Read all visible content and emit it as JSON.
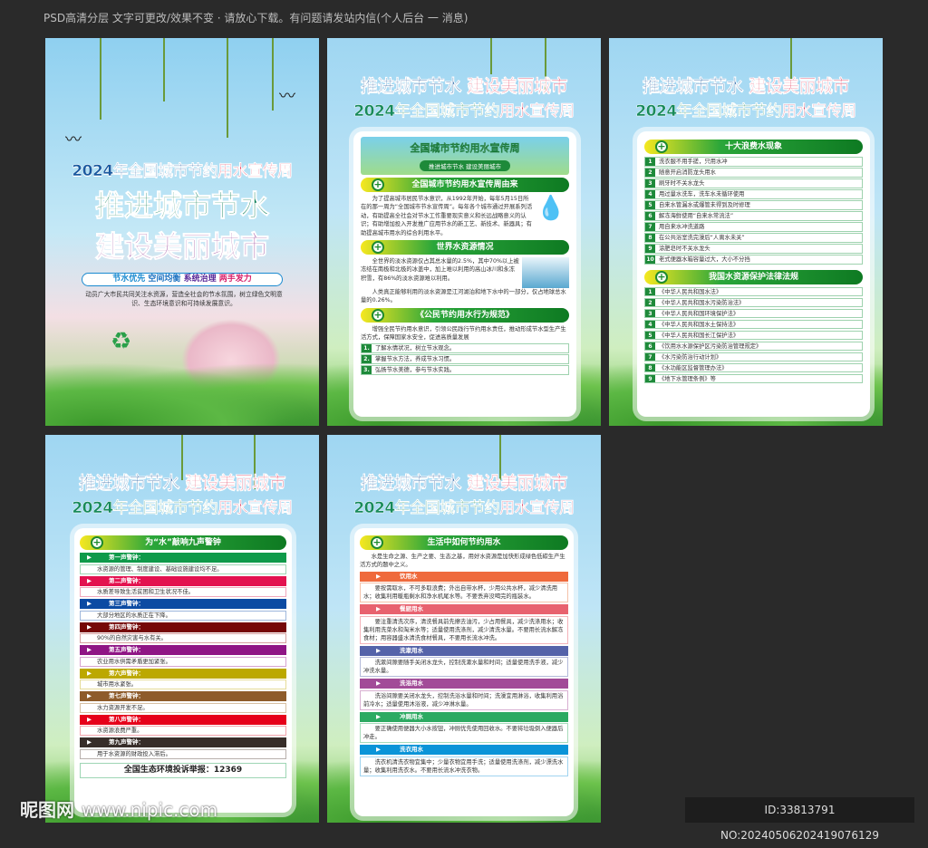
{
  "top_note": "PSD高清分层 文字可更改/效果不变 · 请放心下载。有问题请发站内信(个人后台 一 消息)",
  "headline_a": "推进城市节水",
  "headline_b": "建设美丽城市",
  "headline_b1": "建设",
  "headline_b2": "美丽城市",
  "week_title": "2024年全国城市节约用水宣传周",
  "week_title_a": "2024年全国城市节约",
  "week_title_b": "用水宣传周",
  "cover": {
    "tagline": [
      "节水优先",
      "空间均衡",
      "系统治理",
      "两手发力"
    ],
    "tagline_colors": [
      "#1a8ad0",
      "#1a70c0",
      "#5a2a9a",
      "#d8206a"
    ],
    "body": "动员广大市民共同关注水资源，营造全社会的节水氛围，树立绿色文明意识、生态环境意识和可持续发展意识。"
  },
  "poster2": {
    "banner_title": "全国城市节约用水宣传周",
    "banner_sub": "推进城市节水 建设美丽城市",
    "sec1_title": "全国城市节约用水宣传周由来",
    "sec1_body": "为了提高城市居民节水意识，从1992年开始，每年5月15日所在的那一周为“全国城市节水宣传周”。每年各个城市通过开展系列活动，有助提高全社会对节水工作重要现实意义和长远战略意义的认识；有助增加投入开发推广应用节水的新工艺、新技术、新器具；有助提高城市用水的综合利用水平。",
    "sec2_title": "世界水资源情况",
    "sec2_body1": "全世界的淡水资源仅占其总水量的2.5%，其中70%以上被冻结在南极和北极的冰盖中，加上难以利用的高山冰川和永冻积雪，有86%的淡水资源难以利用。",
    "sec2_body2": "人类真正能够利用的淡水资源是江河湖泊和地下水中的一部分，仅占地球总水量的0.26%。",
    "sec3_title": "《公民节约用水行为规范》",
    "sec3_body": "增强全民节约用水意识，引领公民践行节约用水责任，推动形成节水型生产生活方式，保障国家水安全，促进高质量发展",
    "rules": [
      {
        "n": "1.",
        "t": "了解水情状况，树立节水观念。"
      },
      {
        "n": "2.",
        "t": "掌握节水方法，养成节水习惯。"
      },
      {
        "n": "3.",
        "t": "弘扬节水美德，参与节水实践。"
      }
    ]
  },
  "poster3": {
    "waste_title": "十大浪费水现象",
    "waste": [
      {
        "n": "1",
        "t": "洗衣服不用手搓，只用水冲"
      },
      {
        "n": "2",
        "t": "随意开启消防龙头用水"
      },
      {
        "n": "3",
        "t": "刷牙时不关水龙头"
      },
      {
        "n": "4",
        "t": "用过量水洗车，洗车水未循环使用"
      },
      {
        "n": "5",
        "t": "自来水管漏水或爆管未得到及时修理"
      },
      {
        "n": "6",
        "t": "解冻海鲜使用“自来水常流法”"
      },
      {
        "n": "7",
        "t": "用自来水冲洗道路"
      },
      {
        "n": "8",
        "t": "在公共浴室洗完澡后“人离水未关”"
      },
      {
        "n": "9",
        "t": "涂肥皂时不关水龙头"
      },
      {
        "n": "10",
        "t": "老式便器水箱容量过大，大小不分挡"
      }
    ],
    "law_title": "我国水资源保护法律法规",
    "laws": [
      {
        "n": "1",
        "t": "《中华人民共和国水法》"
      },
      {
        "n": "2",
        "t": "《中华人民共和国水污染防治法》"
      },
      {
        "n": "3",
        "t": "《中华人民共和国环境保护法》"
      },
      {
        "n": "4",
        "t": "《中华人民共和国水土保持法》"
      },
      {
        "n": "5",
        "t": "《中华人民共和国长江保护法》"
      },
      {
        "n": "6",
        "t": "《饮用水水源保护区污染防治管理规定》"
      },
      {
        "n": "7",
        "t": "《水污染防治行动计划》"
      },
      {
        "n": "8",
        "t": "《水功能区监督管理办法》"
      },
      {
        "n": "9",
        "t": "《地下水管理条例》等"
      }
    ]
  },
  "poster4": {
    "title": "为“水”敲响九声警钟",
    "alarms": [
      {
        "h": "第一声警钟：",
        "b": "水资源的管理、制度建设、基础设施建设均不足。",
        "color": "#0f9a4a",
        "light": "#9ed6b4"
      },
      {
        "h": "第二声警钟：",
        "b": "水质差导致生活贫困和卫生状况不佳。",
        "color": "#e3124f",
        "light": "#f2a8bc"
      },
      {
        "h": "第三声警钟：",
        "b": "大部分地区的水质正在下降。",
        "color": "#0c4ba3",
        "light": "#9fb8dc"
      },
      {
        "h": "第四声警钟：",
        "b": "90%的自然灾害与水有关。",
        "color": "#760808",
        "light": "#d6a0a0"
      },
      {
        "h": "第五声警钟：",
        "b": "农业用水供需矛盾更加紧张。",
        "color": "#8f1585",
        "light": "#d8a4d2"
      },
      {
        "h": "第六声警钟：",
        "b": "城市用水紧张。",
        "color": "#bca800",
        "light": "#e6dc98"
      },
      {
        "h": "第七声警钟：",
        "b": "水力资源开发不足。",
        "color": "#8e5b2a",
        "light": "#d8c0a4"
      },
      {
        "h": "第八声警钟：",
        "b": "水资源浪费严重。",
        "color": "#e6001a",
        "light": "#f2a4ac"
      },
      {
        "h": "第九声警钟：",
        "b": "用于水资源的财政投入滞后。",
        "color": "#372d29",
        "light": "#b8b0ac"
      }
    ],
    "hotline": "全国生态环境投诉举报：12369"
  },
  "poster5": {
    "title": "生活中如何节约用水",
    "intro": "水是生命之源、生产之要、生态之基，用好水资源是加快形成绿色低碳生产生活方式的题中之义。",
    "sections": [
      {
        "h": "饮用水",
        "b": "要按需取水，不可多取浪费；外出自带水杯，少用公共水杯，减少清洗用水；收集利用暖瓶剩水和净水机尾水等。不要丢弃没喝完的瓶装水。",
        "color": "#ef6a3c",
        "light": "#f5c2aa"
      },
      {
        "h": "餐厨用水",
        "b": "要注重清洗次序，清洗餐具前先擦去油污，少占用餐具，减少洗涤用水；收集利用洗菜水和淘米水等；适量使用洗涤剂，减少清洗水量。不要用长流水解冻食材；用容器盛水清洗食材餐具，不要用长流水冲洗。",
        "color": "#e8626f",
        "light": "#f4b4ba"
      },
      {
        "h": "洗漱用水",
        "b": "洗漱间隙要随手关闭水龙头，控制洗漱水量和时间；适量使用洗手液，减少冲洗水量。",
        "color": "#5563a9",
        "light": "#b4bada"
      },
      {
        "h": "洗浴用水",
        "b": "洗浴间隙要关闭水龙头，控制洗浴水量和时间；洗澡宜用淋浴，收集利用浴前冷水；适量使用沐浴液，减少冲淋水量。",
        "color": "#a24b98",
        "light": "#d8b0d2"
      },
      {
        "h": "冲厕用水",
        "b": "要正确使用便器大小水按钮，冲厕优先使用回收水。不要将垃圾倒入便器后冲走。",
        "color": "#2caa62",
        "light": "#a8dcbc"
      },
      {
        "h": "洗衣用水",
        "b": "洗衣机清洗衣物宜集中；少量衣物宜用手洗；适量使用洗涤剂，减少漂洗水量；收集利用洗衣水。不要用长流水冲洗衣物。",
        "color": "#0a94d8",
        "light": "#a0d4f0"
      }
    ]
  },
  "watermark": {
    "logo": "昵图网",
    "url": "www.nipic.com"
  },
  "id_text": "ID:33813791 NO:20240506202419076129"
}
